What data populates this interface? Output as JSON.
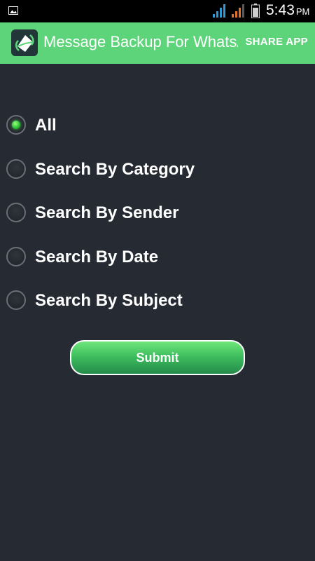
{
  "status_bar": {
    "time": "5:43",
    "ampm": "PM"
  },
  "action_bar": {
    "title": "Message Backup For WhatsApp",
    "share_label": "SHARE APP",
    "color": "#5ed47a"
  },
  "filters": {
    "options": [
      {
        "label": "All",
        "checked": true
      },
      {
        "label": "Search By Category",
        "checked": false
      },
      {
        "label": "Search By Sender",
        "checked": false
      },
      {
        "label": "Search By Date",
        "checked": false
      },
      {
        "label": "Search By Subject",
        "checked": false
      }
    ]
  },
  "submit": {
    "label": "Submit"
  },
  "colors": {
    "background": "#262a33",
    "accent": "#3fbf5e"
  }
}
